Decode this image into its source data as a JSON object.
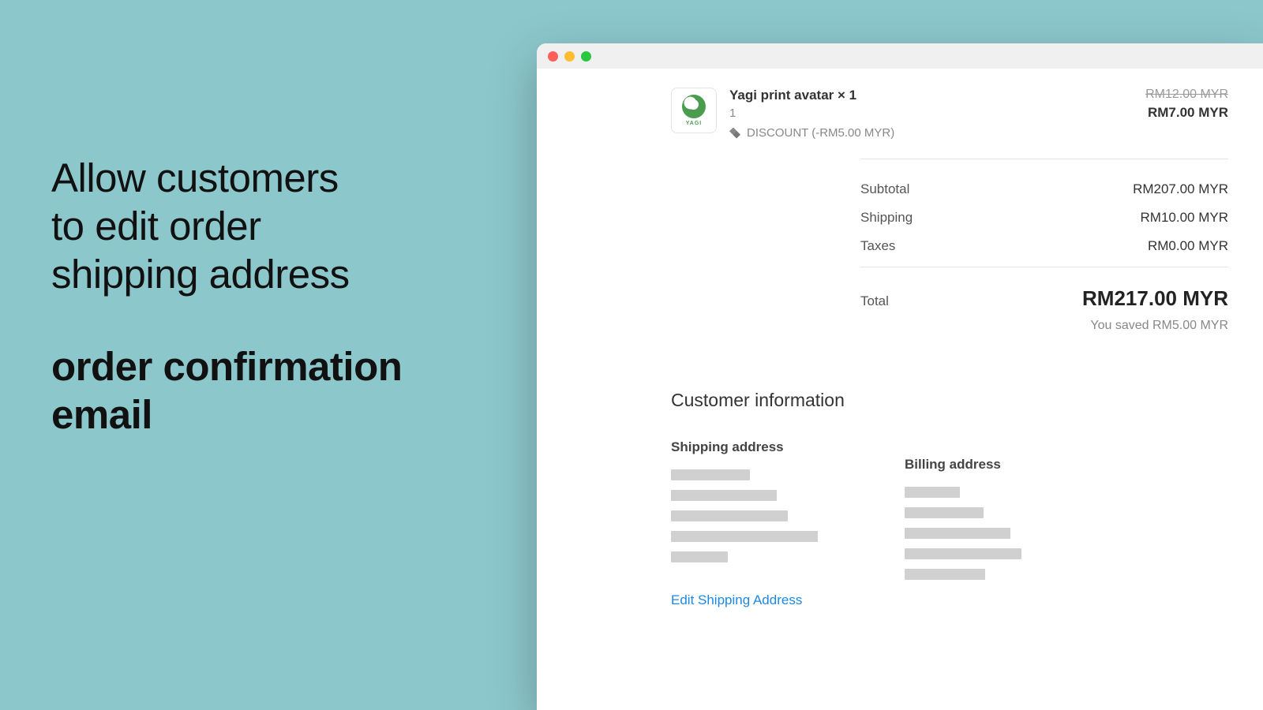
{
  "headline": {
    "line1": "Allow customers",
    "line2": "to edit order",
    "line3": "shipping address",
    "bold1": "order confirmation",
    "bold2": "email"
  },
  "product_thumb_label": "YAGI",
  "line_item": {
    "title": "Yagi print avatar × 1",
    "qty": "1",
    "discount_label": "DISCOUNT (-RM5.00 MYR)",
    "strike_price": "RM12.00 MYR",
    "price": "RM7.00 MYR"
  },
  "totals": {
    "subtotal_label": "Subtotal",
    "subtotal_value": "RM207.00 MYR",
    "shipping_label": "Shipping",
    "shipping_value": "RM10.00 MYR",
    "taxes_label": "Taxes",
    "taxes_value": "RM0.00 MYR",
    "total_label": "Total",
    "total_value": "RM217.00 MYR",
    "saved": "You saved RM5.00 MYR"
  },
  "customer": {
    "heading": "Customer information",
    "shipping_heading": "Shipping address",
    "billing_heading": "Billing address",
    "edit_link": "Edit Shipping Address"
  }
}
